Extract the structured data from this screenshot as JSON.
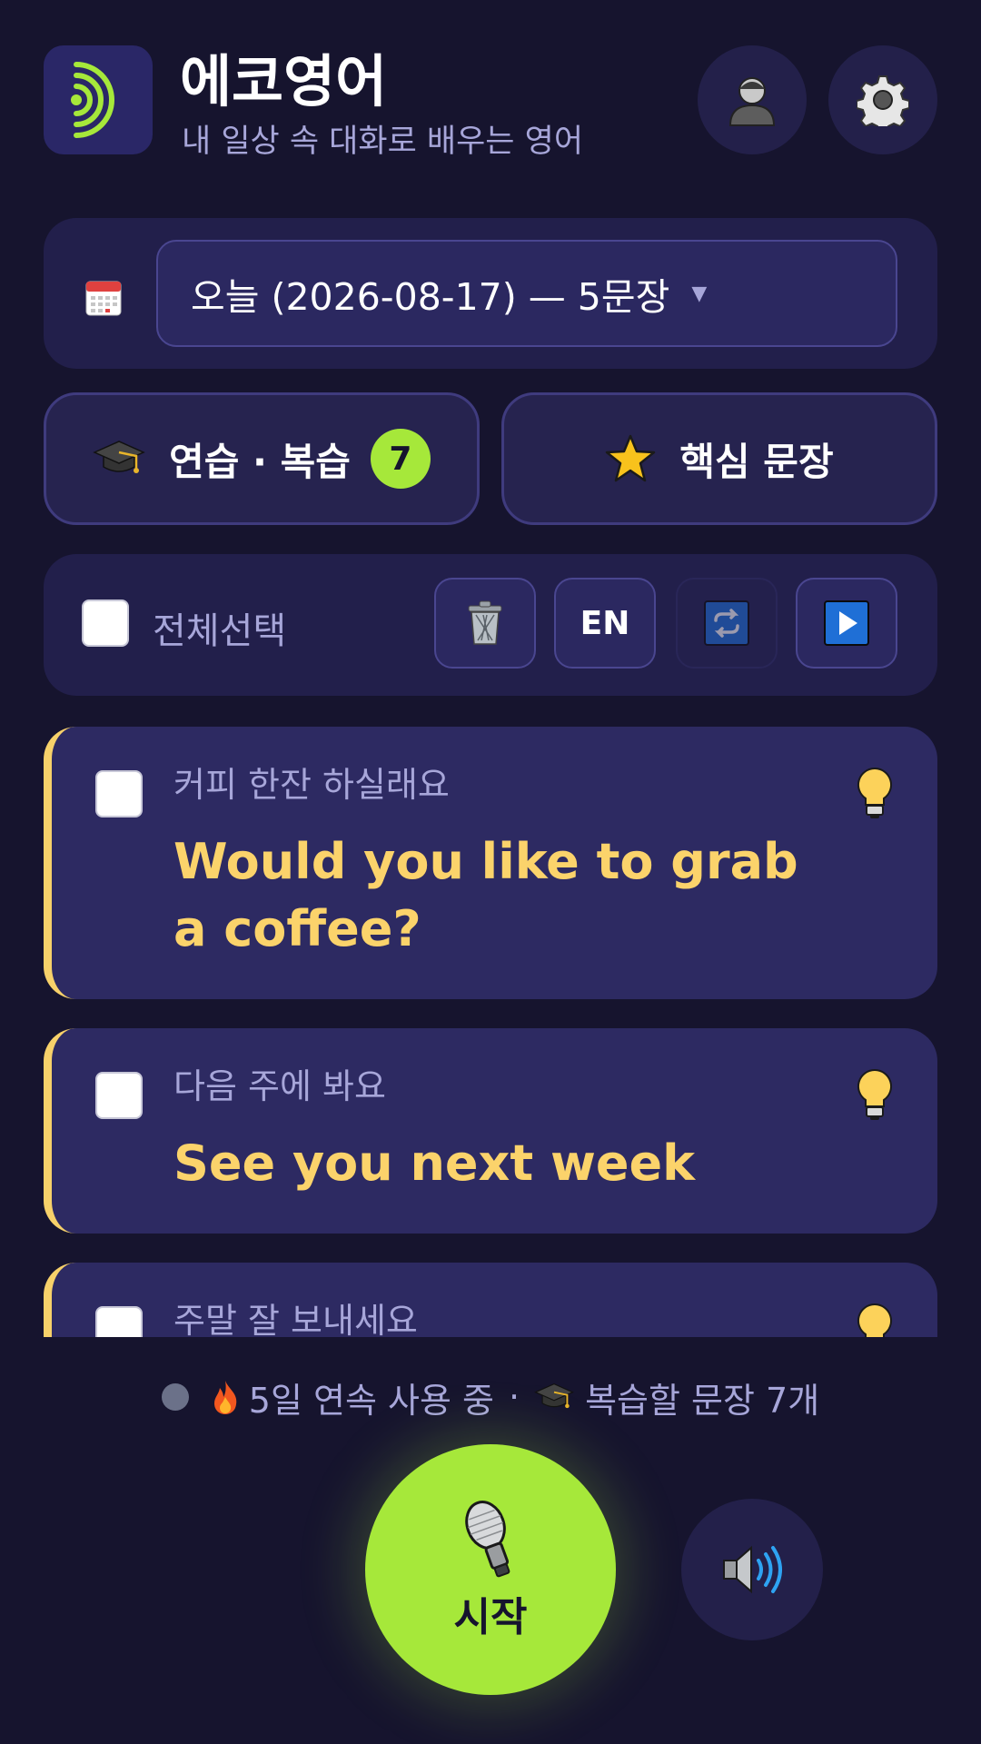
{
  "app": {
    "title": "에코영어",
    "subtitle": "내 일상 속 대화로 배우는 영어",
    "brand_color": "#a6e83a",
    "accent_color": "#fbd36b"
  },
  "header": {
    "logo_icon": "echo-waves-icon",
    "profile_icon": "user-icon",
    "settings_icon": "gear-icon"
  },
  "date_selector": {
    "icon": "calendar-icon",
    "selected": "오늘 (2026-08-17) — 5문장"
  },
  "modes": {
    "practice": {
      "label": "연습 · 복습",
      "badge": "7",
      "icon": "graduation-cap-icon"
    },
    "key_sentences": {
      "label": "핵심 문장",
      "icon": "star-icon"
    }
  },
  "toolbar": {
    "select_all_label": "전체선택",
    "delete_icon": "trash-icon",
    "lang_label": "EN",
    "repeat_icon": "repeat-icon",
    "play_icon": "play-icon"
  },
  "sentences": [
    {
      "ko": "커피 한잔 하실래요",
      "en": "Would you like to grab a coffee?"
    },
    {
      "ko": "다음 주에 봐요",
      "en": "See you next week"
    },
    {
      "ko": "주말 잘 보내세요",
      "en": ""
    }
  ],
  "status": {
    "streak": "5일 연속 사용 중",
    "separator": "·",
    "review": "복습할 문장 7개"
  },
  "controls": {
    "start_label": "시작",
    "mic_icon": "microphone-icon",
    "speaker_icon": "speaker-icon"
  }
}
